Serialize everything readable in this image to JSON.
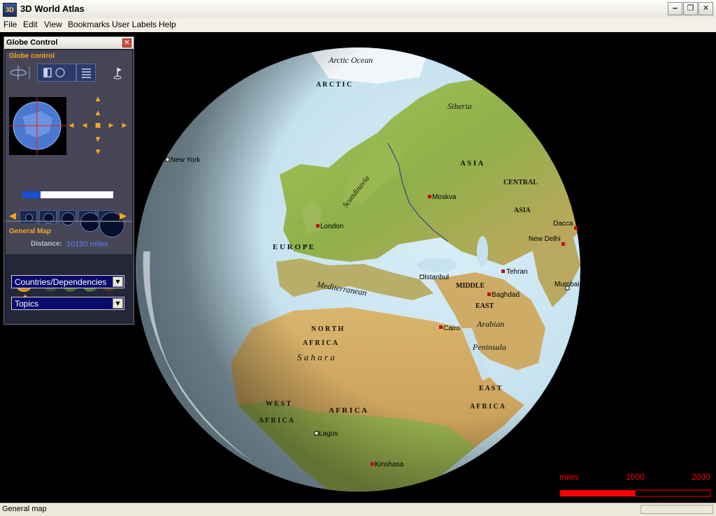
{
  "window": {
    "title": "3D World Atlas",
    "icon_text": "3D",
    "minimize": "‒",
    "restore": "❐",
    "close": "✕"
  },
  "menu": {
    "items": [
      "File",
      "Edit",
      "View",
      "Bookmarks",
      "User Labels",
      "Help"
    ]
  },
  "panel": {
    "title": "Globe Control",
    "close": "✕",
    "section1": "Globe control",
    "distance_label": "Distance:",
    "distance_value": "10150 miles",
    "zoom_level": 0.2,
    "section2": "General Map",
    "dropdown1": "Countries/Dependencies",
    "dropdown2": "Topics"
  },
  "map_labels": [
    {
      "id": "arctic-ocean",
      "text": "Arctic Ocean"
    },
    {
      "id": "arctic",
      "text": "A R C T I C"
    },
    {
      "id": "siberia",
      "text": "Siberia"
    },
    {
      "id": "asia",
      "text": "A S I A"
    },
    {
      "id": "central",
      "text": "CENTRAL"
    },
    {
      "id": "asia2",
      "text": "ASIA"
    },
    {
      "id": "scandinavia",
      "text": "Scandinavia"
    },
    {
      "id": "europe",
      "text": "E U R O P E"
    },
    {
      "id": "middle",
      "text": "MIDDLE"
    },
    {
      "id": "east",
      "text": "EAST"
    },
    {
      "id": "mediterranean",
      "text": "Mediterranean"
    },
    {
      "id": "arabian",
      "text": "Arabian"
    },
    {
      "id": "peninsula",
      "text": "Peninsula"
    },
    {
      "id": "north",
      "text": "N O R T H"
    },
    {
      "id": "africa",
      "text": "A F R I C A"
    },
    {
      "id": "sahara",
      "text": "S a h a r a"
    },
    {
      "id": "east2",
      "text": "E A S T"
    },
    {
      "id": "africa2",
      "text": "A F R I C A"
    },
    {
      "id": "west",
      "text": "W E S T"
    },
    {
      "id": "africa3",
      "text": "A F R I C A"
    },
    {
      "id": "africa4",
      "text": "A F R I C A"
    }
  ],
  "cities": [
    {
      "id": "new-york",
      "text": "New York",
      "type": "hollow"
    },
    {
      "id": "moskva",
      "text": "Moskva",
      "type": "filled"
    },
    {
      "id": "london",
      "text": "London",
      "type": "filled"
    },
    {
      "id": "dacca",
      "text": "Dacca",
      "type": "filled"
    },
    {
      "id": "new-delhi",
      "text": "New Delhi",
      "type": "filled"
    },
    {
      "id": "tehran",
      "text": "Tehran",
      "type": "filled"
    },
    {
      "id": "istanbul",
      "text": "Istanbul",
      "type": "hollow"
    },
    {
      "id": "mumbai",
      "text": "Mumbai",
      "type": "hollow"
    },
    {
      "id": "baghdad",
      "text": "Baghdad",
      "type": "filled"
    },
    {
      "id": "cairo",
      "text": "Cairo",
      "type": "filled"
    },
    {
      "id": "lagos",
      "text": "Lagos",
      "type": "hollow"
    },
    {
      "id": "kinshasa",
      "text": "Kinshasa",
      "type": "filled"
    }
  ],
  "scale": {
    "unit": "miles",
    "mid": "1000",
    "max": "2000"
  },
  "status": {
    "text": "General map"
  },
  "colors": {
    "scale": "#ff0000",
    "panel_accent": "#f5a623",
    "distance": "#6a7cff"
  }
}
